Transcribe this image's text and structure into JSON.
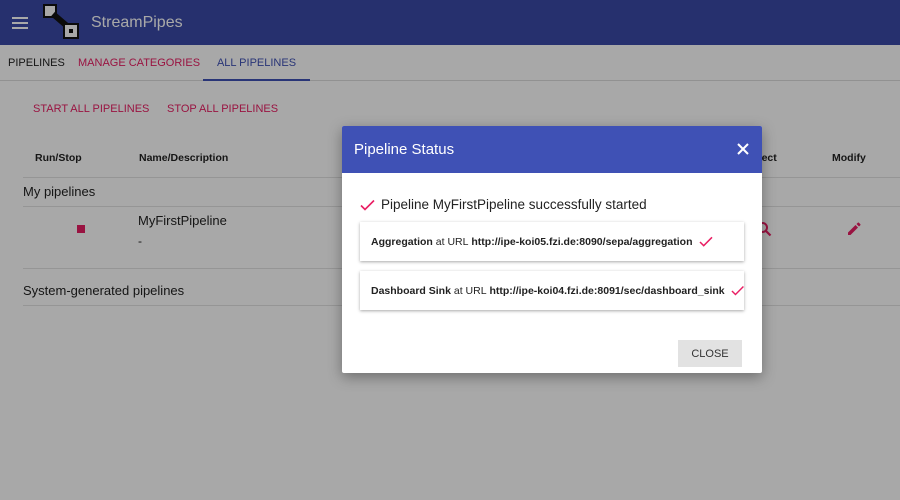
{
  "app": {
    "title": "StreamPipes",
    "icons": {
      "menu": "hamburger-menu-icon",
      "logo": "streampipes-logo"
    }
  },
  "tabs": [
    {
      "label": "PIPELINES",
      "active": false
    },
    {
      "label": "MANAGE CATEGORIES",
      "active": false
    },
    {
      "label": "ALL PIPELINES",
      "active": true
    }
  ],
  "actions": {
    "start_all": "START ALL PIPELINES",
    "stop_all": "STOP ALL PIPELINES"
  },
  "table": {
    "headers": {
      "run_stop": "Run/Stop",
      "name_description": "Name/Description",
      "inspect": "Inspect",
      "modify": "Modify"
    },
    "sections": {
      "my_pipelines": "My pipelines",
      "system_generated": "System-generated pipelines"
    },
    "rows": [
      {
        "name": "MyFirstPipeline",
        "description": "-"
      }
    ]
  },
  "dialog": {
    "title": "Pipeline Status",
    "message": "Pipeline MyFirstPipeline successfully started",
    "url_prefix": "at URL",
    "elements": [
      {
        "name": "Aggregation",
        "url": "http://ipe-koi05.fzi.de:8090/sepa/aggregation"
      },
      {
        "name": "Dashboard Sink",
        "url": "http://ipe-koi04.fzi.de:8091/sec/dashboard_sink"
      }
    ],
    "close_label": "CLOSE"
  },
  "colors": {
    "primary": "#3f51b5",
    "topbar": "#3a4aa8",
    "accent": "#e91e63",
    "overlay": "rgba(0,0,0,0.34)"
  }
}
